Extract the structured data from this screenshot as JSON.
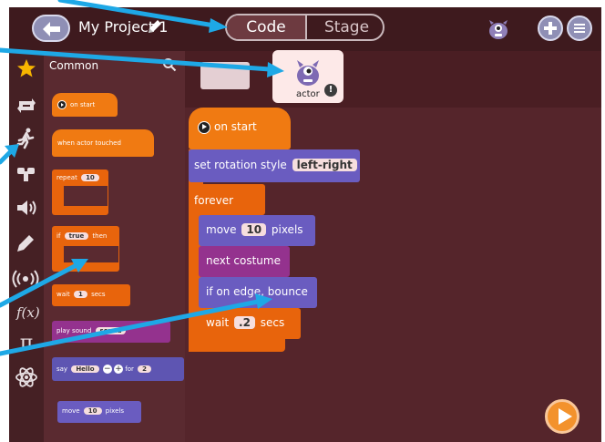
{
  "header": {
    "project_title": "My Project 1",
    "tabs": [
      {
        "label": "Code",
        "selected": true
      },
      {
        "label": "Stage",
        "selected": false
      }
    ]
  },
  "palette": {
    "category_name": "Common",
    "blocks": {
      "on_start": "on start",
      "when_touched": "when actor touched",
      "repeat_label": "repeat",
      "repeat_count": "10",
      "if_label": "if",
      "if_value": "true",
      "then_label": "then",
      "wait_label": "wait",
      "wait_value": "1",
      "secs_label": "secs",
      "play_sound_label": "play sound",
      "sound_value": "sound",
      "say_label": "say",
      "say_value": "Hello",
      "for_label": "for",
      "for_value": "2",
      "move_label": "move",
      "move_value": "10",
      "pixels_label": "pixels"
    }
  },
  "sprites": {
    "actor_label": "actor"
  },
  "script": {
    "on_start": "on start",
    "rotation_label": "set rotation style",
    "rotation_value": "left-right",
    "forever": "forever",
    "move_label": "move",
    "move_value": "10",
    "pixels_label": "pixels",
    "next_costume": "next costume",
    "bounce": "if on edge, bounce",
    "wait_label": "wait",
    "wait_value": ".2",
    "secs_label": "secs"
  },
  "colors": {
    "background": "#4a1e23",
    "orange_block": "#e8640c",
    "purple_block": "#6a5cc0",
    "magenta_block": "#94328e",
    "annotation_arrow": "#1ea8e6"
  },
  "icons": {
    "left_column": [
      "events-icon",
      "motion-icon",
      "looks-icon",
      "sound-icon",
      "pen-icon",
      "broadcast-icon",
      "function-icon",
      "math-icon",
      "physics-icon"
    ]
  }
}
